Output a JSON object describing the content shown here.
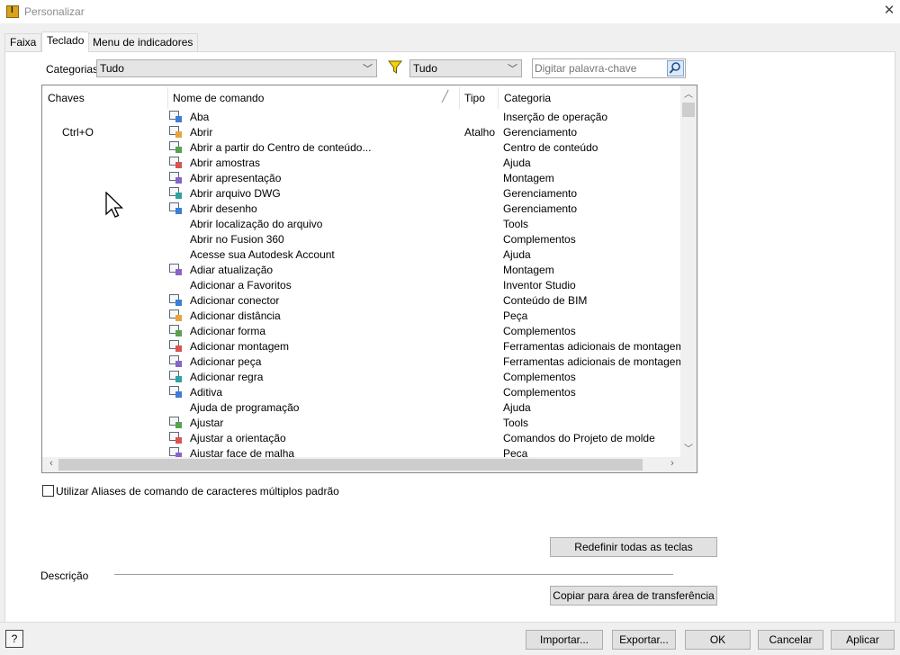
{
  "window": {
    "title": "Personalizar"
  },
  "tabs": [
    {
      "label": "Faixa"
    },
    {
      "label": "Teclado"
    },
    {
      "label": "Menu de indicadores"
    }
  ],
  "filters": {
    "category_label": "Categorias:",
    "category_value": "Tudo",
    "type_value": "Tudo",
    "search_placeholder": "Digitar palavra-chave"
  },
  "table": {
    "headers": {
      "keys": "Chaves",
      "name": "Nome de comando",
      "type": "Tipo",
      "category": "Categoria"
    },
    "rows": [
      {
        "key": "",
        "name": "Aba",
        "type": "",
        "category": "Inserção de operação",
        "icon": "tab-icon"
      },
      {
        "key": "Ctrl+O",
        "name": "Abrir",
        "type": "Atalho",
        "category": "Gerenciamento",
        "icon": "open-folder-icon"
      },
      {
        "key": "",
        "name": "Abrir a partir do Centro de conteúdo...",
        "type": "",
        "category": "Centro de conteúdo",
        "icon": "content-center-icon"
      },
      {
        "key": "",
        "name": "Abrir amostras",
        "type": "",
        "category": "Ajuda",
        "icon": "samples-icon"
      },
      {
        "key": "",
        "name": "Abrir apresentação",
        "type": "",
        "category": "Montagem",
        "icon": "presentation-icon"
      },
      {
        "key": "",
        "name": "Abrir arquivo DWG",
        "type": "",
        "category": "Gerenciamento",
        "icon": "dwg-icon"
      },
      {
        "key": "",
        "name": "Abrir desenho",
        "type": "",
        "category": "Gerenciamento",
        "icon": "drawing-icon"
      },
      {
        "key": "",
        "name": "Abrir localização do arquivo",
        "type": "",
        "category": "Tools",
        "icon": ""
      },
      {
        "key": "",
        "name": "Abrir no Fusion 360",
        "type": "",
        "category": "Complementos",
        "icon": ""
      },
      {
        "key": "",
        "name": "Acesse sua Autodesk Account",
        "type": "",
        "category": "Ajuda",
        "icon": ""
      },
      {
        "key": "",
        "name": "Adiar atualização",
        "type": "",
        "category": "Montagem",
        "icon": "defer-update-icon"
      },
      {
        "key": "",
        "name": "Adicionar a Favoritos",
        "type": "",
        "category": "Inventor Studio",
        "icon": ""
      },
      {
        "key": "",
        "name": "Adicionar conector",
        "type": "",
        "category": "Conteúdo de BIM",
        "icon": "connector-icon"
      },
      {
        "key": "",
        "name": "Adicionar distância",
        "type": "",
        "category": "Peça",
        "icon": "distance-icon"
      },
      {
        "key": "",
        "name": "Adicionar forma",
        "type": "",
        "category": "Complementos",
        "icon": "add-form-icon"
      },
      {
        "key": "",
        "name": "Adicionar montagem",
        "type": "",
        "category": "Ferramentas adicionais de montagem",
        "icon": "add-assembly-icon"
      },
      {
        "key": "",
        "name": "Adicionar peça",
        "type": "",
        "category": "Ferramentas adicionais de montagem",
        "icon": "add-part-icon"
      },
      {
        "key": "",
        "name": "Adicionar regra",
        "type": "",
        "category": "Complementos",
        "icon": "add-rule-icon"
      },
      {
        "key": "",
        "name": "Aditiva",
        "type": "",
        "category": "Complementos",
        "icon": "additive-icon"
      },
      {
        "key": "",
        "name": "Ajuda de programação",
        "type": "",
        "category": "Ajuda",
        "icon": ""
      },
      {
        "key": "",
        "name": "Ajustar",
        "type": "",
        "category": "Tools",
        "icon": "adjust-icon"
      },
      {
        "key": "",
        "name": "Ajustar a orientação",
        "type": "",
        "category": "Comandos do Projeto de molde",
        "icon": "orientation-icon"
      },
      {
        "key": "",
        "name": "Ajustar face de malha",
        "type": "",
        "category": "Peça",
        "icon": "mesh-face-icon"
      }
    ]
  },
  "checkbox": {
    "label": "Utilizar Aliases de comando de caracteres múltiplos padrão"
  },
  "buttons": {
    "reset": "Redefinir todas as teclas",
    "copy": "Copiar para área de transferência",
    "import": "Importar...",
    "export": "Exportar...",
    "ok": "OK",
    "cancel": "Cancelar",
    "apply": "Aplicar",
    "help": "?"
  },
  "description": {
    "label": "Descrição"
  },
  "colors": {
    "accent": "#2d6fc4",
    "filter": "#e8c21a",
    "border": "#adadad"
  }
}
